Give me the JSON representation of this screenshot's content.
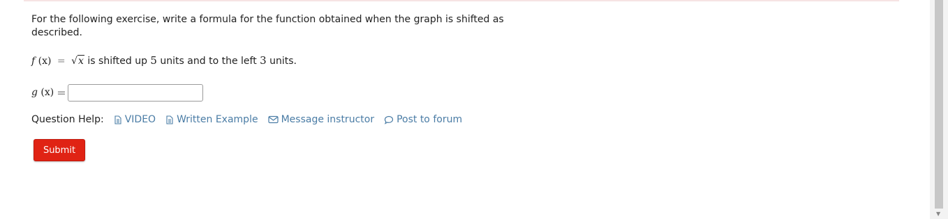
{
  "question": {
    "prompt": "For the following exercise, write a formula for the function obtained when the graph is shifted as described.",
    "func_name": "f",
    "func_arg": "(x)",
    "equals": "=",
    "radicand": "x",
    "text_shifted_up": "is shifted up",
    "up_amount": "5",
    "text_units_left": "units and to the left",
    "left_amount": "3",
    "text_units_end": "units."
  },
  "answer": {
    "func_name": "g",
    "func_arg": "(x)",
    "equals": "=",
    "value": ""
  },
  "help": {
    "label": "Question Help:",
    "links": [
      {
        "label": "VIDEO",
        "icon": "document-icon"
      },
      {
        "label": "Written Example",
        "icon": "document-icon"
      },
      {
        "label": "Message instructor",
        "icon": "envelope-icon"
      },
      {
        "label": "Post to forum",
        "icon": "speech-bubble-icon"
      }
    ]
  },
  "submit": {
    "label": "Submit"
  },
  "colors": {
    "link": "#4a7ca5",
    "submit": "#e02314"
  }
}
